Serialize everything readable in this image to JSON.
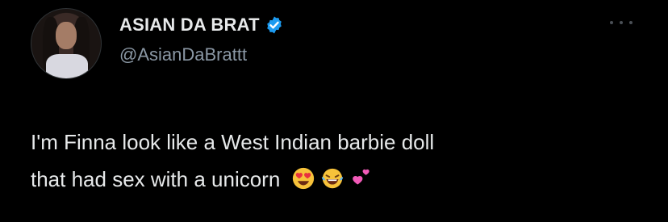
{
  "tweet": {
    "display_name": "ASIAN DA BRAT",
    "handle": "@AsianDaBrattt",
    "text_line_1": "I'm Finna look like a West Indian barbie doll",
    "text_line_2": "that had sex with a unicorn",
    "emojis": [
      "heart-eyes-emoji",
      "tears-of-joy-emoji",
      "two-hearts-emoji"
    ]
  },
  "colors": {
    "background": "#000000",
    "text": "#e7e9ea",
    "secondary_text": "#8b98a5",
    "verified_badge": "#1d9bf0"
  },
  "icons": {
    "verified": "verified-badge-icon",
    "more": "more-options-icon"
  }
}
